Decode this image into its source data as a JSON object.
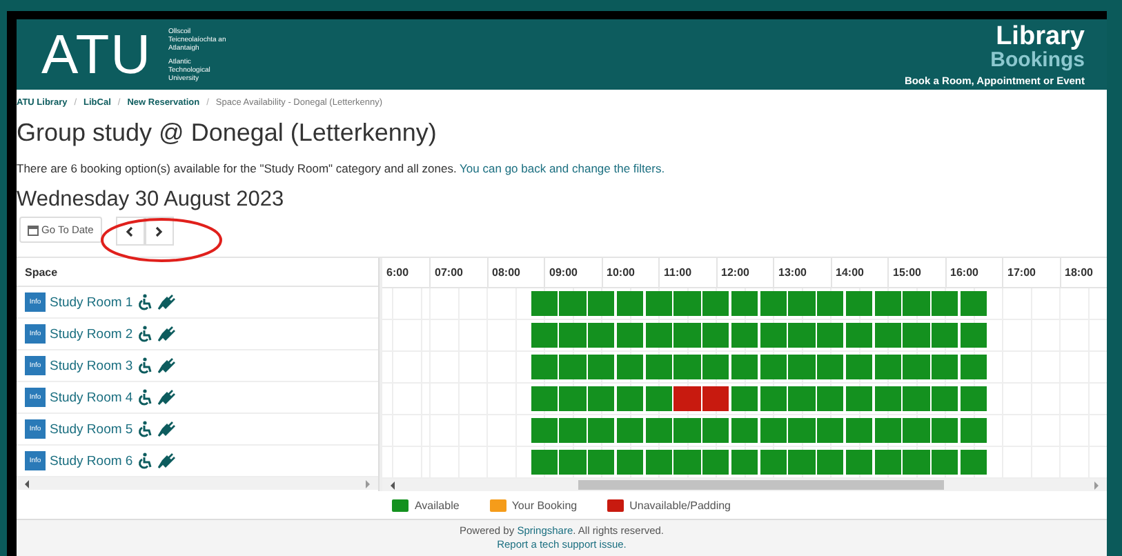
{
  "header": {
    "logo": "ATU",
    "logo_lines": [
      "Ollscoil Teicneolaíochta an Atlantaigh",
      "Atlantic Technological University"
    ],
    "title": "Library",
    "subtitle": "Bookings",
    "tagline": "Book a Room, Appointment  or Event"
  },
  "breadcrumbs": {
    "separator": "/",
    "items": [
      {
        "label": "ATU Library",
        "link": true
      },
      {
        "label": "LibCal",
        "link": true
      },
      {
        "label": "New Reservation",
        "link": true
      },
      {
        "label": "Space Availability - Donegal (Letterkenny)",
        "link": false
      }
    ]
  },
  "page_title": "Group study @ Donegal (Letterkenny)",
  "intro": {
    "text": "There are 6 booking option(s) available for the \"Study Room\" category and all zones.",
    "link": "You can go back and change the filters."
  },
  "date_heading": "Wednesday 30 August 2023",
  "go_to_date": "Go To Date",
  "grid": {
    "space_header": "Space",
    "hours": [
      "6:00",
      "07:00",
      "08:00",
      "09:00",
      "10:00",
      "11:00",
      "12:00",
      "13:00",
      "14:00",
      "15:00",
      "16:00",
      "17:00",
      "18:00"
    ],
    "rows": [
      {
        "info": "Info",
        "name": "Study Room 1",
        "slots": [
          {
            "available": true
          },
          {
            "available": true
          },
          {
            "available": true
          },
          {
            "available": true
          },
          {
            "available": true
          },
          {
            "available": true
          },
          {
            "available": true
          },
          {
            "available": true
          },
          {
            "available": true
          },
          {
            "available": true
          },
          {
            "available": true
          },
          {
            "available": true
          },
          {
            "available": true
          },
          {
            "available": true
          },
          {
            "available": true
          },
          {
            "available": true
          }
        ]
      },
      {
        "info": "Info",
        "name": "Study Room 2",
        "slots": [
          {
            "available": true
          },
          {
            "available": true
          },
          {
            "available": true
          },
          {
            "available": true
          },
          {
            "available": true
          },
          {
            "available": true
          },
          {
            "available": true
          },
          {
            "available": true
          },
          {
            "available": true
          },
          {
            "available": true
          },
          {
            "available": true
          },
          {
            "available": true
          },
          {
            "available": true
          },
          {
            "available": true
          },
          {
            "available": true
          },
          {
            "available": true
          }
        ]
      },
      {
        "info": "Info",
        "name": "Study Room 3",
        "slots": [
          {
            "available": true
          },
          {
            "available": true
          },
          {
            "available": true
          },
          {
            "available": true
          },
          {
            "available": true
          },
          {
            "available": true
          },
          {
            "available": true
          },
          {
            "available": true
          },
          {
            "available": true
          },
          {
            "available": true
          },
          {
            "available": true
          },
          {
            "available": true
          },
          {
            "available": true
          },
          {
            "available": true
          },
          {
            "available": true
          },
          {
            "available": true
          }
        ]
      },
      {
        "info": "Info",
        "name": "Study Room 4",
        "slots": [
          {
            "available": true
          },
          {
            "available": true
          },
          {
            "available": true
          },
          {
            "available": true
          },
          {
            "available": true
          },
          {
            "available": false
          },
          {
            "available": false
          },
          {
            "available": true
          },
          {
            "available": true
          },
          {
            "available": true
          },
          {
            "available": true
          },
          {
            "available": true
          },
          {
            "available": true
          },
          {
            "available": true
          },
          {
            "available": true
          },
          {
            "available": true
          }
        ]
      },
      {
        "info": "Info",
        "name": "Study Room 5",
        "slots": [
          {
            "available": true
          },
          {
            "available": true
          },
          {
            "available": true
          },
          {
            "available": true
          },
          {
            "available": true
          },
          {
            "available": true
          },
          {
            "available": true
          },
          {
            "available": true
          },
          {
            "available": true
          },
          {
            "available": true
          },
          {
            "available": true
          },
          {
            "available": true
          },
          {
            "available": true
          },
          {
            "available": true
          },
          {
            "available": true
          },
          {
            "available": true
          }
        ]
      },
      {
        "info": "Info",
        "name": "Study Room 6",
        "slots": [
          {
            "available": true
          },
          {
            "available": true
          },
          {
            "available": true
          },
          {
            "available": true
          },
          {
            "available": true
          },
          {
            "available": true
          },
          {
            "available": true
          },
          {
            "available": true
          },
          {
            "available": true
          },
          {
            "available": true
          },
          {
            "available": true
          },
          {
            "available": true
          },
          {
            "available": true
          },
          {
            "available": true
          },
          {
            "available": true
          },
          {
            "available": true
          }
        ]
      }
    ]
  },
  "legend": [
    {
      "label": "Available",
      "color": "#14911f"
    },
    {
      "label": "Your Booking",
      "color": "#f59c1a"
    },
    {
      "label": "Unavailable/Padding",
      "color": "#c81a0f"
    }
  ],
  "footer": {
    "before": "Powered by ",
    "link": "Springshare",
    "after": ". All rights reserved.",
    "support": "Report a tech support issue."
  }
}
